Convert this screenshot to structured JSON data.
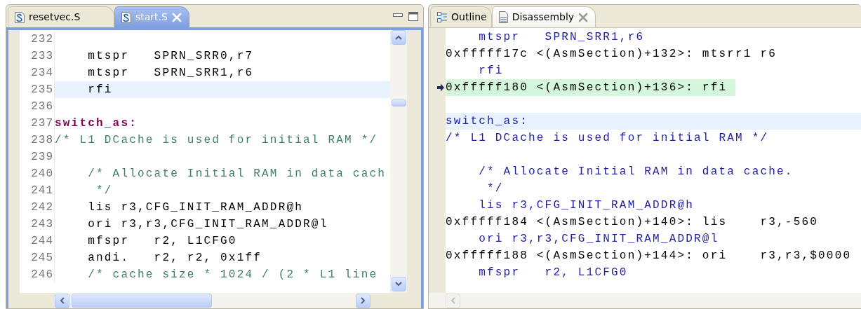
{
  "editor": {
    "tabs": [
      {
        "label": "resetvec.S",
        "selected": false
      },
      {
        "label": "start.S",
        "selected": true
      }
    ],
    "lines": [
      {
        "number": "232",
        "kind": "blank",
        "cursor": false
      },
      {
        "number": "233",
        "text": "    mtspr   SPRN_SRR0,r7",
        "kind": "code",
        "cursor": false
      },
      {
        "number": "234",
        "text": "    mtspr   SPRN_SRR1,r6",
        "kind": "code",
        "cursor": false
      },
      {
        "number": "235",
        "text": "    rfi",
        "kind": "code",
        "cursor": true
      },
      {
        "number": "236",
        "kind": "blank",
        "cursor": false
      },
      {
        "number": "237",
        "text": "switch_as:",
        "kind": "label",
        "cursor": false
      },
      {
        "number": "238",
        "text": "/* L1 DCache is used for initial RAM */",
        "kind": "comment",
        "cursor": false
      },
      {
        "number": "239",
        "kind": "blank",
        "cursor": false
      },
      {
        "number": "240",
        "text": "    /* Allocate Initial RAM in data cach",
        "kind": "comment",
        "cursor": false
      },
      {
        "number": "241",
        "text": "     */",
        "kind": "comment",
        "cursor": false
      },
      {
        "number": "242",
        "text": "    lis r3,CFG_INIT_RAM_ADDR@h",
        "kind": "code",
        "cursor": false
      },
      {
        "number": "243",
        "text": "    ori r3,r3,CFG_INIT_RAM_ADDR@l",
        "kind": "code",
        "cursor": false
      },
      {
        "number": "244",
        "text": "    mfspr   r2, L1CFG0",
        "kind": "code",
        "cursor": false
      },
      {
        "number": "245",
        "text": "    andi.   r2, r2, 0x1ff",
        "kind": "code",
        "cursor": false
      },
      {
        "number": "246",
        "text": "    /* cache size * 1024 / (2 * L1 line",
        "kind": "comment",
        "cursor": false
      }
    ]
  },
  "disassembly": {
    "tabs": [
      {
        "label": "Outline",
        "selected": false
      },
      {
        "label": "Disassembly",
        "selected": true
      }
    ],
    "lines": [
      {
        "text": "    mtspr   SPRN_SRR1,r6",
        "kind": "source",
        "current": false,
        "cursor": false
      },
      {
        "text": "0xfffff17c <(AsmSection)+132>: mtsrr1 r6",
        "kind": "instruction",
        "current": false,
        "cursor": false
      },
      {
        "text": "    rfi",
        "kind": "source",
        "current": false,
        "cursor": false
      },
      {
        "text": "0xfffff180 <(AsmSection)+136>: rfi",
        "kind": "instruction",
        "current": true,
        "cursor": false
      },
      {
        "kind": "blank",
        "current": false,
        "cursor": false
      },
      {
        "text": "switch_as:",
        "kind": "source",
        "current": false,
        "cursor": true
      },
      {
        "text": "/* L1 DCache is used for initial RAM */",
        "kind": "source",
        "current": false,
        "cursor": false
      },
      {
        "kind": "blank",
        "current": false,
        "cursor": false
      },
      {
        "text": "    /* Allocate Initial RAM in data cache.",
        "kind": "source",
        "current": false,
        "cursor": false
      },
      {
        "text": "     */",
        "kind": "source",
        "current": false,
        "cursor": false
      },
      {
        "text": "    lis r3,CFG_INIT_RAM_ADDR@h",
        "kind": "source",
        "current": false,
        "cursor": false
      },
      {
        "text": "0xfffff184 <(AsmSection)+140>: lis    r3,-560",
        "kind": "instruction",
        "current": false,
        "cursor": false
      },
      {
        "text": "    ori r3,r3,CFG_INIT_RAM_ADDR@l",
        "kind": "source",
        "current": false,
        "cursor": false
      },
      {
        "text": "0xfffff188 <(AsmSection)+144>: ori    r3,r3,$0000",
        "kind": "instruction",
        "current": false,
        "cursor": false
      },
      {
        "text": "    mfspr   r2, L1CFG0",
        "kind": "source",
        "current": false,
        "cursor": false
      }
    ]
  }
}
